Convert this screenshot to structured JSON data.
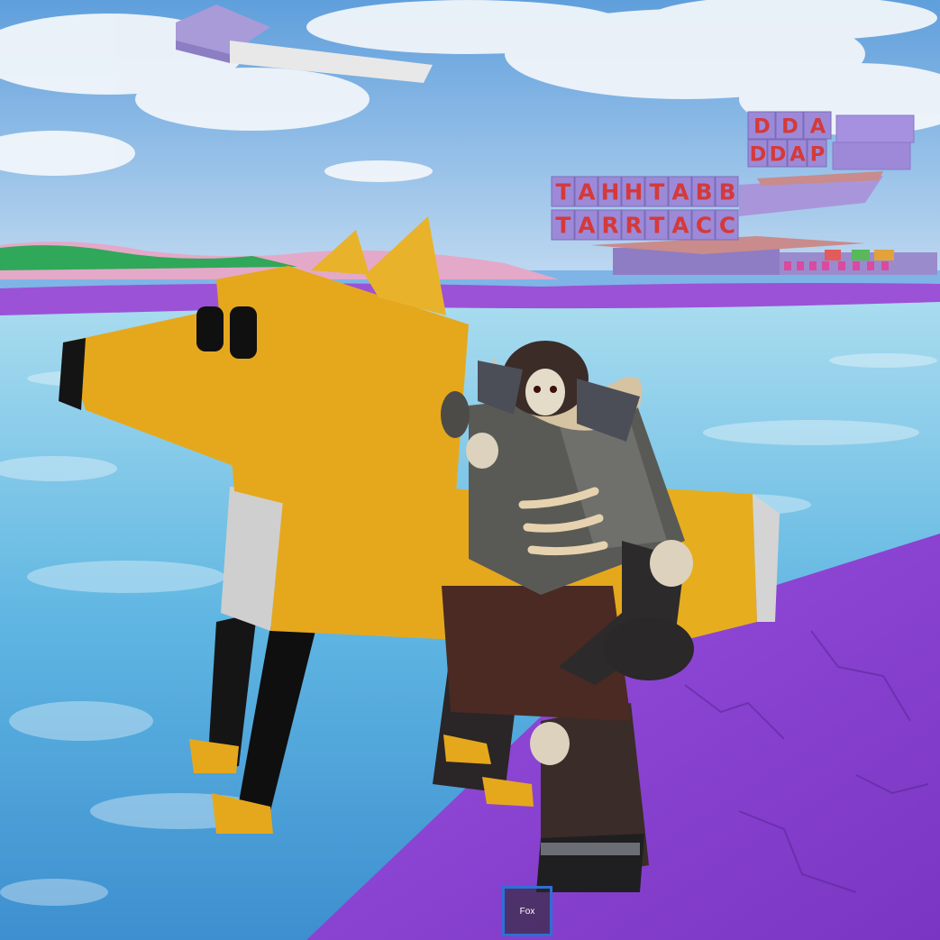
{
  "scene": {
    "signs": {
      "upper_right_row1": [
        "D",
        "D",
        "A"
      ],
      "upper_right_row2": [
        "D",
        "D",
        "A",
        "P"
      ],
      "center_row1": [
        "T",
        "A",
        "H",
        "H",
        "T",
        "A",
        "B",
        "B"
      ],
      "center_row2": [
        "T",
        "A",
        "R",
        "R",
        "T",
        "A",
        "C",
        "C"
      ]
    },
    "colors": {
      "sky": "#7fb4e6",
      "water": "#6fc2e6",
      "purple_ground": "#8a3fd1",
      "fox_body": "#e3a91c",
      "sign_block": "#9c8ad9",
      "sign_letter": "#d43a3a"
    }
  },
  "hotbar": {
    "slot_label": "Fox",
    "border_color": "#2f6fd6"
  }
}
